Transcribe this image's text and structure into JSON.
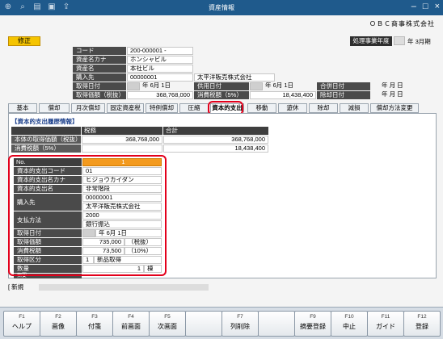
{
  "window": {
    "title": "資産情報",
    "company": "ＯＢＣ商事株式会社"
  },
  "mode_badge": "修正",
  "fiscal_year": {
    "label": "処理事業年度",
    "text": "年 3月期"
  },
  "header": {
    "code_label": "コード",
    "code_value": "200-000001 -",
    "kana_label": "資産名カナ",
    "kana_value": "ホンシャビル",
    "name_label": "資産名",
    "name_value": "本社ビル",
    "vendor_label": "購入先",
    "vendor_code": "00000001",
    "vendor_name": "太平洋販売株式会社",
    "acq_date_label": "取得日付",
    "acq_date_value": "年  6月  1日",
    "use_date_label": "供用日付",
    "use_date_value": "年  6月  1日",
    "merge_date_label": "合併日付",
    "merge_date_value": "年    月    日",
    "acq_price_label": "取得価額（税抜）",
    "acq_price_value": "368,768,000",
    "tax_label": "消費税額（5%）",
    "tax_value": "18,438,400",
    "disposal_label": "除却日付",
    "disposal_value": "年    月    日"
  },
  "tabs": [
    "基本",
    "償却",
    "月次償却",
    "固定資産税",
    "特例償却",
    "圧縮",
    "資本的支出",
    "移動",
    "遊休",
    "除却",
    "減損",
    "償却方法変更"
  ],
  "active_tab": "資本的支出",
  "history": {
    "title": "【資本的支出履歴情報】",
    "col_tax": "税務",
    "col_total": "合計",
    "row1_label": "本体の取得価額（税抜）",
    "row1_tax": "368,768,000",
    "row1_total": "368,768,000",
    "row2_label": "消費税額（5%）",
    "row2_tax": "",
    "row2_total": "18,438,400"
  },
  "detail": {
    "no_label": "No.",
    "no_value": "1",
    "code_label": "資本的支出コード",
    "code_value": "01",
    "kana_label": "資本的支出名カナ",
    "kana_value": "ヒジョウカイダン",
    "name_label": "資本的支出名",
    "name_value": "非常階段",
    "vendor_label": "購入先",
    "vendor_code": "00000001",
    "vendor_name": "太平洋販売株式会社",
    "payment_label": "支払方法",
    "payment_code": "2000",
    "payment_name": "銀行振込",
    "date_label": "取得日付",
    "date_value": "年  6月  1日",
    "price_label": "取得価額",
    "price_value": "735,000",
    "price_note": "（税抜）",
    "tax_label": "消費税額",
    "tax_value": "73,500",
    "tax_note": "（10%）",
    "category_label": "取得区分",
    "category_code": "1",
    "category_name": "新品取得",
    "qty_label": "数量",
    "qty_value": "1",
    "qty_unit": "棟",
    "summary_label": "摘要"
  },
  "status": {
    "prefix": "[ 新規"
  },
  "fkeys": [
    {
      "key": "F1",
      "label": "ヘルプ"
    },
    {
      "key": "F2",
      "label": "画像"
    },
    {
      "key": "F3",
      "label": "付箋"
    },
    {
      "key": "F4",
      "label": "前画面"
    },
    {
      "key": "F5",
      "label": "次画面"
    },
    {
      "key": "",
      "label": ""
    },
    {
      "key": "F7",
      "label": "列削除"
    },
    {
      "key": "",
      "label": ""
    },
    {
      "key": "F9",
      "label": "摘要登録"
    },
    {
      "key": "F10",
      "label": "中止"
    },
    {
      "key": "F11",
      "label": "ガイド"
    },
    {
      "key": "F12",
      "label": "登録"
    }
  ],
  "colors": {
    "accent_red": "#e3001b",
    "title_bar": "#1f5a8c",
    "badge_yellow": "#f5c400",
    "no_orange": "#f39a1e"
  }
}
